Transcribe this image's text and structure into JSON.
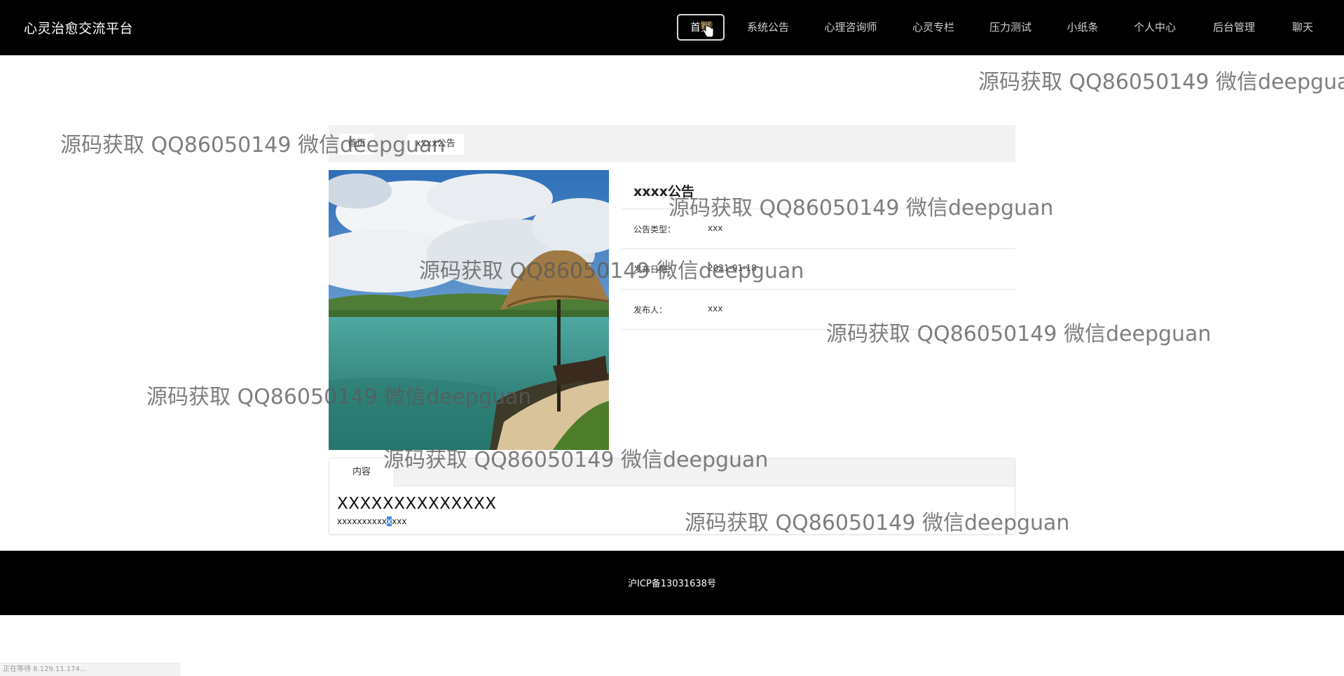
{
  "header": {
    "site_title": "心灵治愈交流平台",
    "nav": [
      {
        "label": "首页",
        "active": true
      },
      {
        "label": "系统公告",
        "active": false
      },
      {
        "label": "心理咨询师",
        "active": false
      },
      {
        "label": "心灵专栏",
        "active": false
      },
      {
        "label": "压力测试",
        "active": false
      },
      {
        "label": "小纸条",
        "active": false
      },
      {
        "label": "个人中心",
        "active": false
      },
      {
        "label": "后台管理",
        "active": false
      },
      {
        "label": "聊天",
        "active": false
      }
    ]
  },
  "breadcrumb": {
    "home": "首页",
    "current": "xxxx公告"
  },
  "detail": {
    "title": "xxxx公告",
    "rows": [
      {
        "label": "公告类型：",
        "value": "xxx"
      },
      {
        "label": "发布日期：",
        "value": "2021-01-18"
      },
      {
        "label": "发布人：",
        "value": "xxx"
      }
    ]
  },
  "content": {
    "tab_label": "内容",
    "heading": "XXXXXXXXXXXXXX",
    "text_before": "xxxxxxxxxx",
    "text_selected": "x",
    "text_after": "xxx"
  },
  "footer": {
    "icp": "沪ICP备13031638号"
  },
  "status_bar": {
    "text": "正在等待 8.129.11.174..."
  },
  "watermark": {
    "text": "源码获取 QQ86050149 微信deepguan"
  },
  "colors": {
    "header_bg": "#000000",
    "footer_bg": "#000000",
    "breadcrumb_bg": "#f2f2f2",
    "selection": "#3a8ee6"
  }
}
